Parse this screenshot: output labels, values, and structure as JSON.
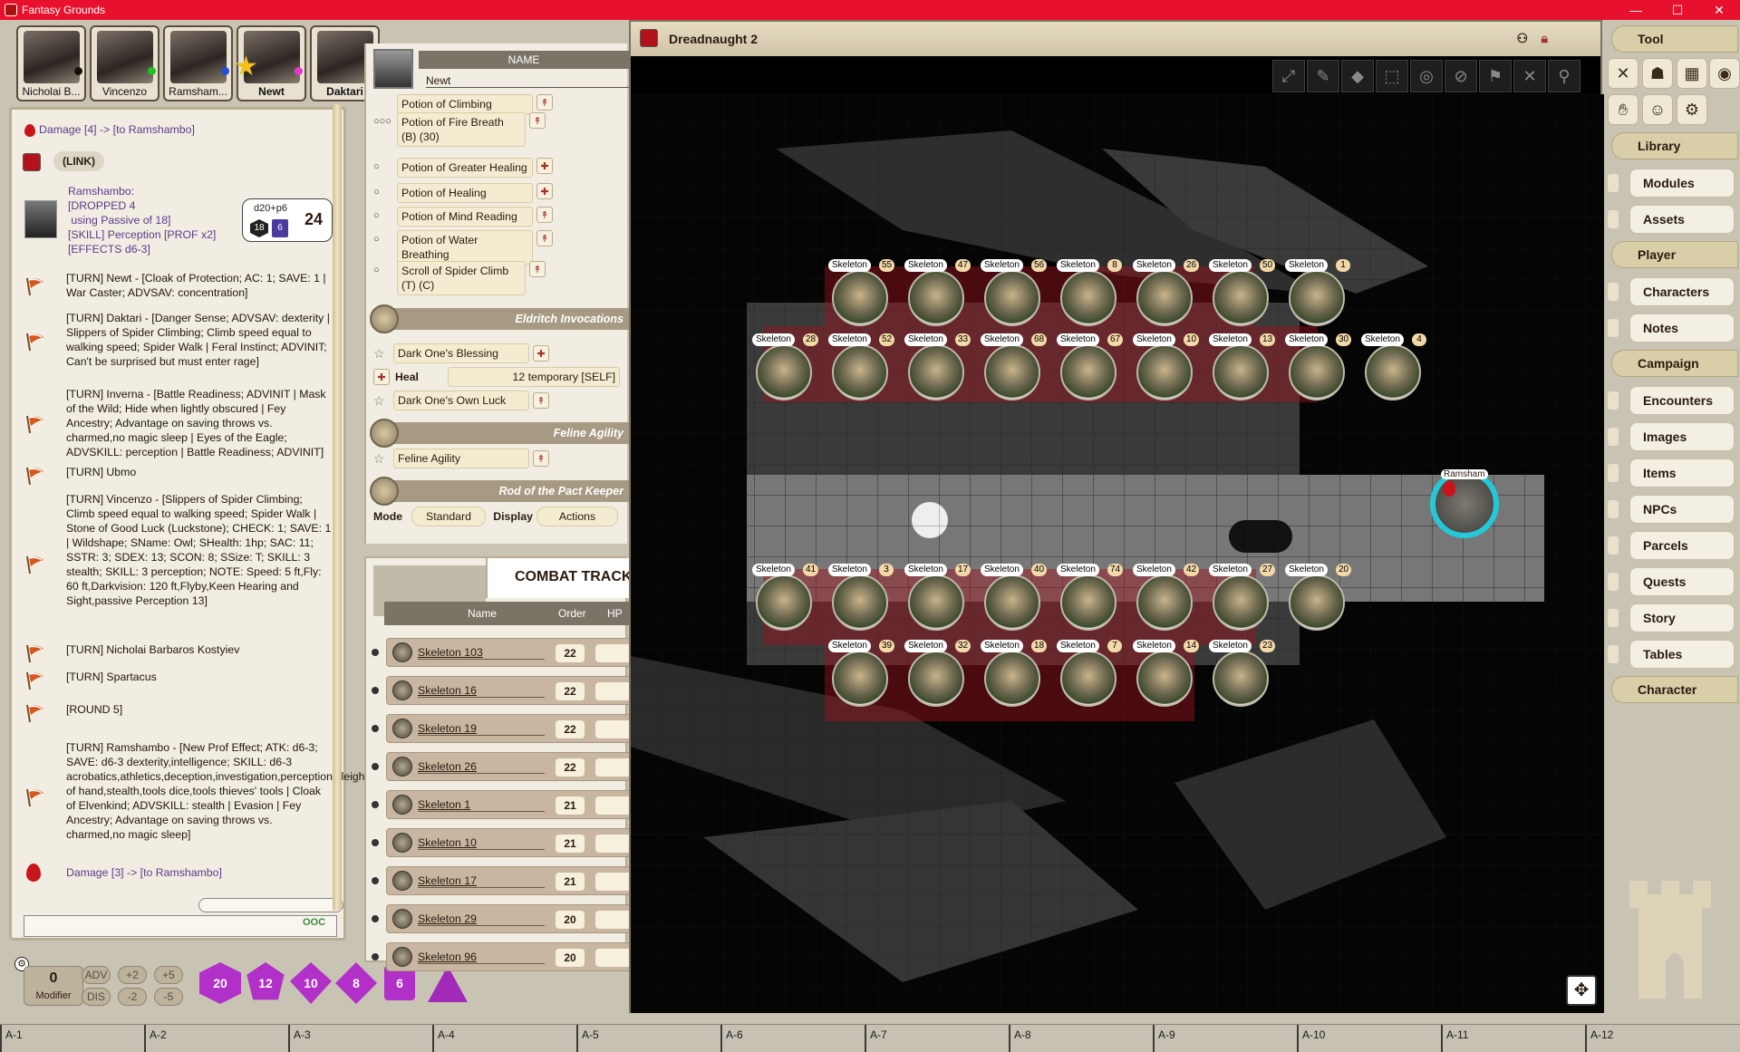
{
  "window": {
    "title": "Fantasy Grounds",
    "controls": [
      "—",
      "☐",
      "✕"
    ]
  },
  "portraits": [
    {
      "name": "Nicholai B...",
      "dot": "#111111",
      "bold": false
    },
    {
      "name": "Vincenzo",
      "dot": "#1ec31e",
      "bold": false
    },
    {
      "name": "Ramsham...",
      "dot": "#2a4bd8",
      "bold": false
    },
    {
      "name": "Newt",
      "dot": "#e53ad2",
      "bold": true
    },
    {
      "name": "Daktari",
      "dot": "",
      "bold": true
    }
  ],
  "chat": {
    "top_damage": "Damage [4] -> [to Ramshambo]",
    "link_label": "(LINK)",
    "roll": {
      "lines": [
        "Ramshambo:",
        "[DROPPED 4",
        " using Passive of 18]",
        "[SKILL] Perception [PROF x2]",
        "[EFFECTS d6-3]"
      ],
      "formula": "d20+p6",
      "die1": "18",
      "die2": "6",
      "total": "24"
    },
    "turns": [
      "[TURN] Newt - [Cloak of Protection; AC: 1; SAVE: 1 | War Caster; ADVSAV: concentration]",
      "[TURN] Daktari - [Danger Sense; ADVSAV: dexterity | Slippers of Spider Climbing; Climb speed equal to walking speed; Spider Walk | Feral Instinct; ADVINIT; Can't be surprised but must enter rage]",
      "[TURN] Inverna - [Battle Readiness; ADVINIT | Mask of the Wild; Hide when lightly obscured | Fey Ancestry; Advantage on saving throws vs. charmed,no magic sleep | Eyes of the Eagle; ADVSKILL: perception | Battle Readiness; ADVINIT]",
      "[TURN] Ubmo",
      "[TURN] Vincenzo - [Slippers of Spider Climbing; Climb speed equal to walking speed; Spider Walk | Stone of Good Luck (Luckstone); CHECK: 1; SAVE: 1 | Wildshape; SName: Owl; SHealth: 1hp; SAC: 11; SSTR: 3; SDEX: 13; SCON: 8; SSize: T; SKILL: 3 stealth; SKILL: 3 perception; NOTE: Speed: 5 ft,Fly: 60 ft,Darkvision: 120 ft,Flyby,Keen Hearing and Sight,passive Perception 13]",
      "[TURN] Nicholai Barbaros Kostyiev",
      "[TURN] Spartacus",
      "[ROUND 5]",
      "[TURN] Ramshambo - [New Prof Effect; ATK: d6-3; SAVE: d6-3 dexterity,intelligence; SKILL: d6-3 acrobatics,athletics,deception,investigation,perception,sleight of hand,stealth,tools dice,tools thieves' tools | Cloak of Elvenkind; ADVSKILL: stealth | Evasion | Fey Ancestry; Advantage on saving throws vs. charmed,no magic sleep]"
    ],
    "bottom_damage": "Damage [3] -> [to Ramshambo]",
    "input_value": "",
    "ooc_label": "OOC"
  },
  "dice": {
    "modifier_value": "0",
    "modifier_label": "Modifier",
    "buttons": [
      "ADV",
      "+2",
      "+5",
      "DIS",
      "-2",
      "-5"
    ],
    "dice_labels": [
      "20",
      "12",
      "10",
      "8",
      "6",
      ""
    ]
  },
  "character": {
    "name_header": "NAME",
    "name_value": "Newt",
    "items": [
      {
        "label": "Potion of Climbing",
        "uses": ""
      },
      {
        "label": "Potion of Fire Breath (B) (30)",
        "uses": "○○○"
      },
      {
        "label": "Potion of Greater Healing",
        "uses": "○"
      },
      {
        "label": "Potion of Healing",
        "uses": "○"
      },
      {
        "label": "Potion of Mind Reading",
        "uses": "○"
      },
      {
        "label": "Potion of Water Breathing",
        "uses": "○"
      },
      {
        "label": "Scroll of Spider Climb (T) (C)",
        "uses": "○"
      }
    ],
    "sections": [
      {
        "title": "Eldritch Invocations"
      },
      {
        "title": "Feline Agility"
      },
      {
        "title": "Rod of the Pact Keeper"
      }
    ],
    "invocations": [
      "Dark One's Blessing",
      "Dark One's Own Luck"
    ],
    "heal_label": "Heal",
    "heal_value": "12 temporary [SELF]",
    "feline": "Feline Agility",
    "mode_label": "Mode",
    "mode_value": "Standard",
    "display_label": "Display",
    "display_value": "Actions"
  },
  "combat_tracker": {
    "title": "COMBAT TRACKE",
    "col_name": "Name",
    "col_order": "Order",
    "col_hp": "HP",
    "rows": [
      {
        "name": "Skeleton 103",
        "order": "22"
      },
      {
        "name": "Skeleton 16",
        "order": "22"
      },
      {
        "name": "Skeleton 19",
        "order": "22"
      },
      {
        "name": "Skeleton 26",
        "order": "22"
      },
      {
        "name": "Skeleton 1",
        "order": "21"
      },
      {
        "name": "Skeleton 10",
        "order": "21"
      },
      {
        "name": "Skeleton 17",
        "order": "21"
      },
      {
        "name": "Skeleton 29",
        "order": "20"
      },
      {
        "name": "Skeleton 96",
        "order": "20"
      }
    ]
  },
  "map": {
    "title": "Dreadnaught 2",
    "token_label": "Skeleton",
    "player_token": "Ramsham",
    "rows": [
      [
        "55",
        "47",
        "56",
        "8",
        "26",
        "50",
        "1"
      ],
      [
        "28",
        "52",
        "33",
        "68",
        "67",
        "10",
        "13",
        "30",
        "4"
      ],
      [
        "41",
        "3",
        "17",
        "40",
        "74",
        "42",
        "27",
        "20"
      ],
      [
        "39",
        "32",
        "18",
        "7",
        "14",
        "23"
      ]
    ]
  },
  "sidebar": {
    "tool_head": "Tool",
    "library_head": "Library",
    "library_items": [
      "Modules",
      "Assets"
    ],
    "player_head": "Player",
    "player_items": [
      "Characters",
      "Notes"
    ],
    "campaign_head": "Campaign",
    "campaign_items": [
      "Encounters",
      "Images",
      "Items",
      "NPCs",
      "Parcels",
      "Quests",
      "Story",
      "Tables"
    ],
    "character_head": "Character"
  },
  "hotkeys": [
    "A-1",
    "A-2",
    "A-3",
    "A-4",
    "A-5",
    "A-6",
    "A-7",
    "A-8",
    "A-9",
    "A-10",
    "A-11",
    "A-12"
  ]
}
